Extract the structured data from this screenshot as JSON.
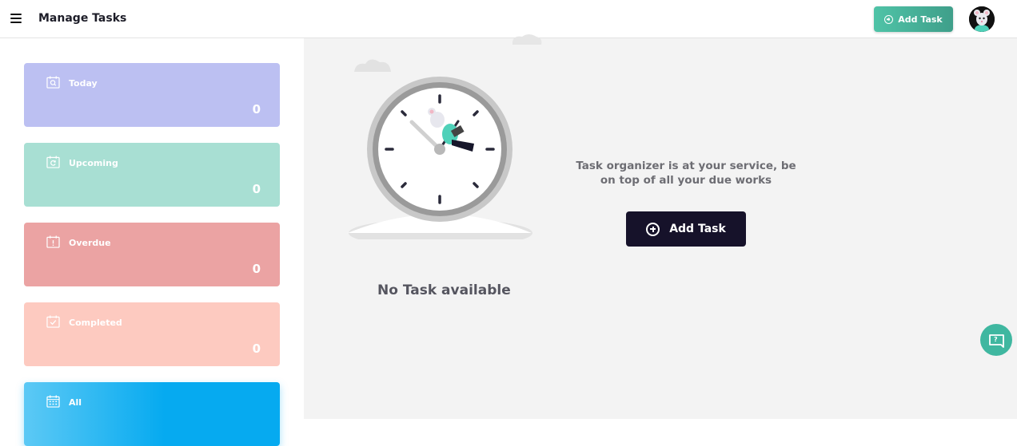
{
  "header": {
    "title": "Manage Tasks",
    "add_task_label": "Add Task"
  },
  "sidebar": {
    "cards": [
      {
        "label": "Today",
        "count": "0",
        "color": "#bcc0f2",
        "icon": "calendar-search-icon"
      },
      {
        "label": "Upcoming",
        "count": "0",
        "color": "#a8dfd3",
        "icon": "calendar-refresh-icon"
      },
      {
        "label": "Overdue",
        "count": "0",
        "color": "#eba3a3",
        "icon": "calendar-alert-icon"
      },
      {
        "label": "Completed",
        "count": "0",
        "color": "#fdcac0",
        "icon": "calendar-check-icon"
      },
      {
        "label": "All",
        "color": "#06aaf0",
        "icon": "calendar-grid-icon"
      }
    ]
  },
  "main": {
    "empty_title": "No Task available",
    "promo_text": "Task organizer is at your service, be on top of all your due works",
    "add_task_label": "Add Task"
  },
  "colors": {
    "accent_teal": "#3fb7a0",
    "dark_button": "#16122a"
  }
}
